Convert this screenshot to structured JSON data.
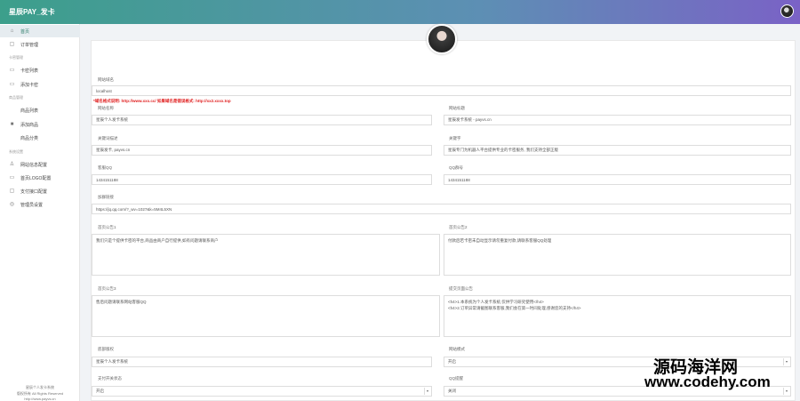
{
  "header": {
    "brand": "星辰PAY_发卡"
  },
  "sidebar": {
    "items": [
      {
        "label": "首页",
        "active": true
      },
      {
        "label": "订单管理"
      },
      {
        "section": "卡密管理"
      },
      {
        "label": "卡密列表"
      },
      {
        "label": "添加卡密"
      },
      {
        "section": "商品管理"
      },
      {
        "label": "商品列表"
      },
      {
        "label": "添加商品"
      },
      {
        "label": "商品分类"
      },
      {
        "section": "系统设置"
      },
      {
        "label": "网站信息配置"
      },
      {
        "label": "首页LOGO配置"
      },
      {
        "label": "支付接口配置"
      },
      {
        "label": "管理员设置"
      }
    ],
    "footer": [
      "星辰个人发卡系统",
      "版权所有 All Rights Reserved",
      "http://www.payvs.cn"
    ]
  },
  "form": {
    "host": {
      "label": "网站域名",
      "value": "localhost"
    },
    "notice": "*域名格式说明: http://www.xxx.cc/ 如果域名是错误格式: http://xx2.xxxx.top",
    "title": {
      "label": "网站名称",
      "value": "星辰个人发卡系统"
    },
    "subtitle": {
      "label": "网站标题",
      "value": "星辰发卡系统 - payvs.cn"
    },
    "keywords": {
      "label": "关键词描述",
      "value": "星辰发卡, payvs.cn"
    },
    "description": {
      "label": "关键字",
      "value": "星辰专门为机器人平台提供专业的卡密服务, 我们支持全部正版"
    },
    "qq": {
      "label": "客服QQ",
      "value": "1434151188"
    },
    "qqgroup": {
      "label": "QQ群号",
      "value": "1434151188"
    },
    "buylink": {
      "label": "加群链接",
      "value": "https://jq.qq.com/?_wv=1027&k=5M4L5XN"
    },
    "notice1": {
      "label": "首页公告1",
      "lines": [
        "我们只是个提供卡密的平台,商品由商户自行提供,如有问题请联系商户"
      ]
    },
    "notice2": {
      "label": "首页公告2",
      "lines": [
        "付款后若卡密未自动显示请勿重复付款,请联系客服QQ处理"
      ]
    },
    "notice3": {
      "label": "首页公告3",
      "lines": [
        "售后问题请联系网站客服QQ"
      ]
    },
    "notice4": {
      "label": "提交页面公告",
      "lines": [
        "<h4>1.本系统为个人发卡系统,仅供学习研究使用</h4>",
        "<h4>2.订单异常请截图联系客服,我们会在第一时间处理,感谢您的支持</h4>"
      ]
    },
    "copyright": {
      "label": "底部版权",
      "value": "星辰个人发卡系统"
    },
    "status": {
      "label": "网站模式",
      "value": "开启"
    },
    "paystatus": {
      "label": "支付开关状态",
      "value": "开启"
    },
    "qqcheck": {
      "label": "QQ提醒",
      "value": "关闭"
    }
  },
  "watermark": {
    "cn": "源码海洋网",
    "url": "www.codehy.com"
  }
}
